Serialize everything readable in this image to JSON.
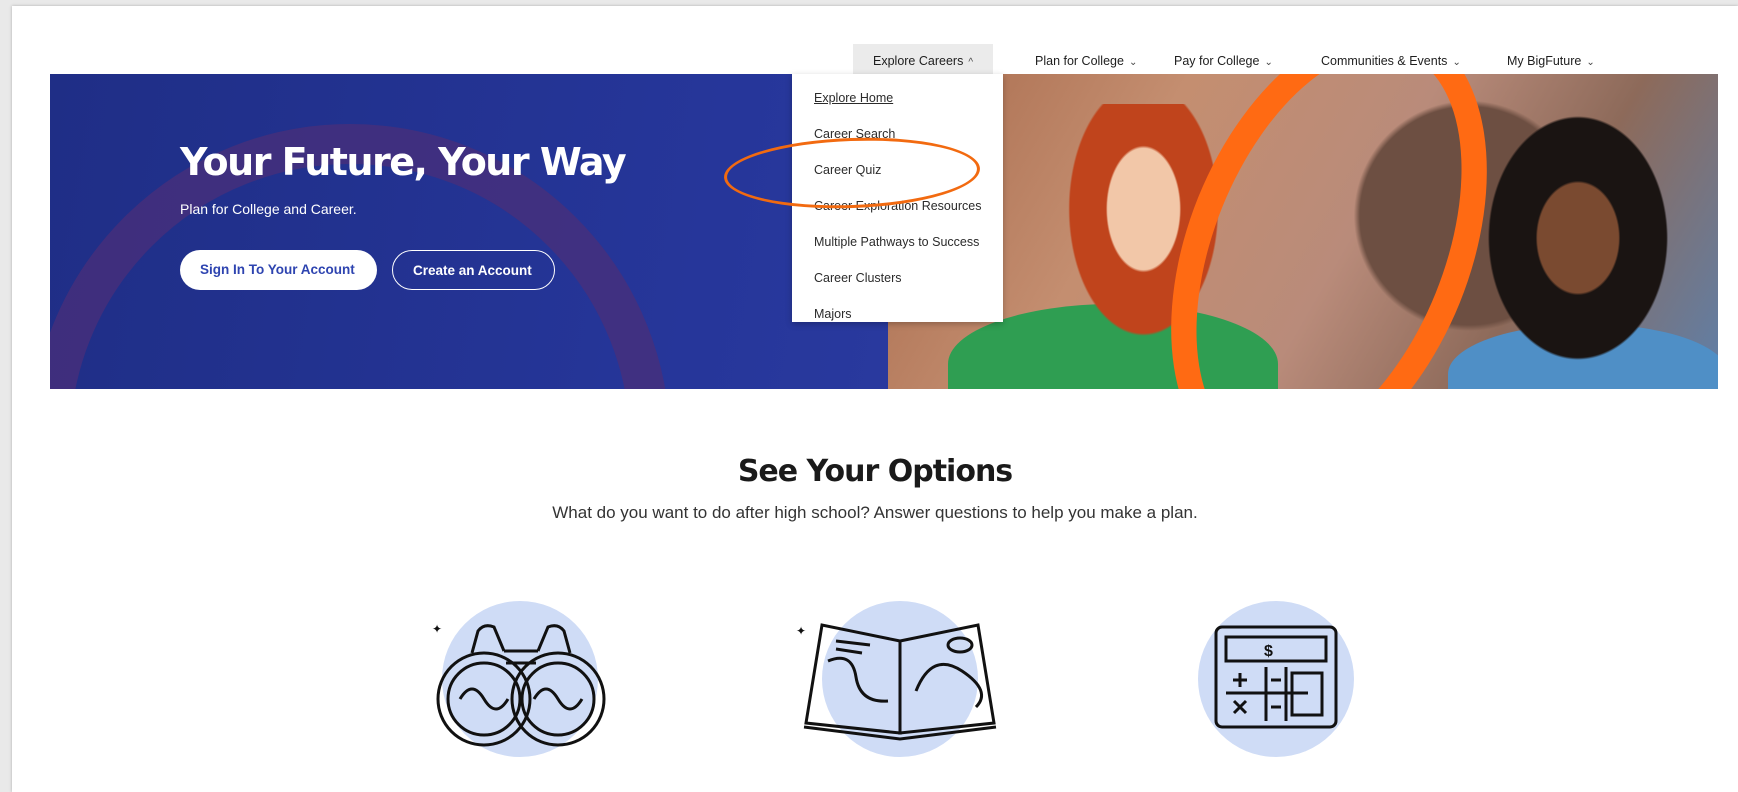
{
  "nav": {
    "items": [
      {
        "label": "Explore Careers",
        "chevron": "^"
      },
      {
        "label": "Plan for College",
        "chevron": "⌄"
      },
      {
        "label": "Pay for College",
        "chevron": "⌄"
      },
      {
        "label": "Communities & Events",
        "chevron": "⌄"
      },
      {
        "label": "My BigFuture",
        "chevron": "⌄"
      }
    ]
  },
  "dropdown": {
    "items": [
      "Explore Home",
      "Career Search",
      "Career Quiz",
      "Career Exploration Resources",
      "Multiple Pathways to Success",
      "Career Clusters",
      "Majors"
    ],
    "highlighted": "Career Quiz",
    "highlight_color": "#f26a10"
  },
  "hero": {
    "title": "Your Future, Your Way",
    "subtitle": "Plan for College and Career.",
    "primary_button": "Sign In To Your Account",
    "secondary_button": "Create an Account",
    "background_color": "#26369a",
    "accent_color": "#ff6a13"
  },
  "options": {
    "title": "See Your Options",
    "subtitle": "What do you want to do after high school? Answer questions to help you make a plan.",
    "icons": [
      "binoculars-icon",
      "open-book-map-icon",
      "calculator-icon"
    ],
    "circle_color": "#cfdcf6"
  }
}
